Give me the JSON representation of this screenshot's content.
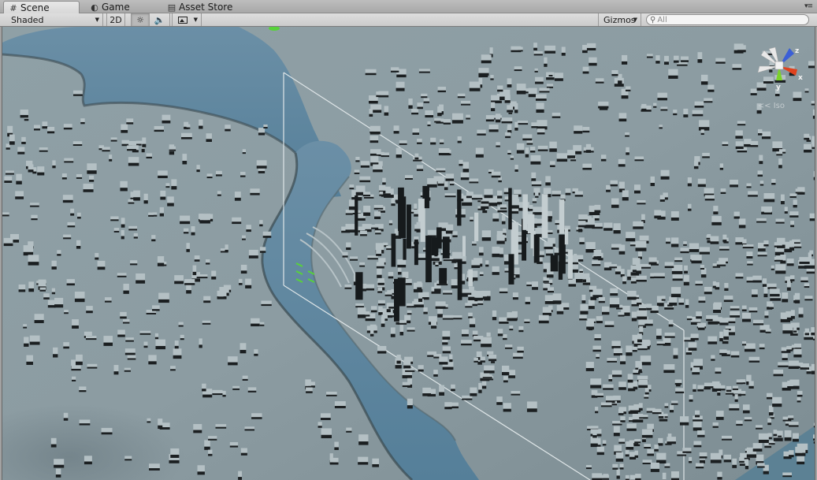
{
  "tabs": [
    {
      "label": "Scene",
      "icon": "grid-icon",
      "active": true
    },
    {
      "label": "Game",
      "icon": "game-icon",
      "active": false
    },
    {
      "label": "Asset Store",
      "icon": "store-bag-icon",
      "active": false
    }
  ],
  "toolbar": {
    "draw_mode": "Shaded",
    "mode_2d": "2D",
    "lighting_icon": "sun-icon",
    "audio_icon": "speaker-icon",
    "effects_icon": "image-icon",
    "gizmos": "Gizmos",
    "search_placeholder": "All"
  },
  "scene_gizmo": {
    "projection": "Iso",
    "axes": {
      "z": "z",
      "x": "x",
      "y": "y"
    },
    "colors": {
      "z": "#3b5fd6",
      "x": "#e0421e",
      "y": "#7bd22b",
      "neutral": "#e8e8e8"
    }
  },
  "colors": {
    "ground": "#8d9ea4",
    "water": "#5e8aa3",
    "selection_outline": "#dfe6e8"
  }
}
